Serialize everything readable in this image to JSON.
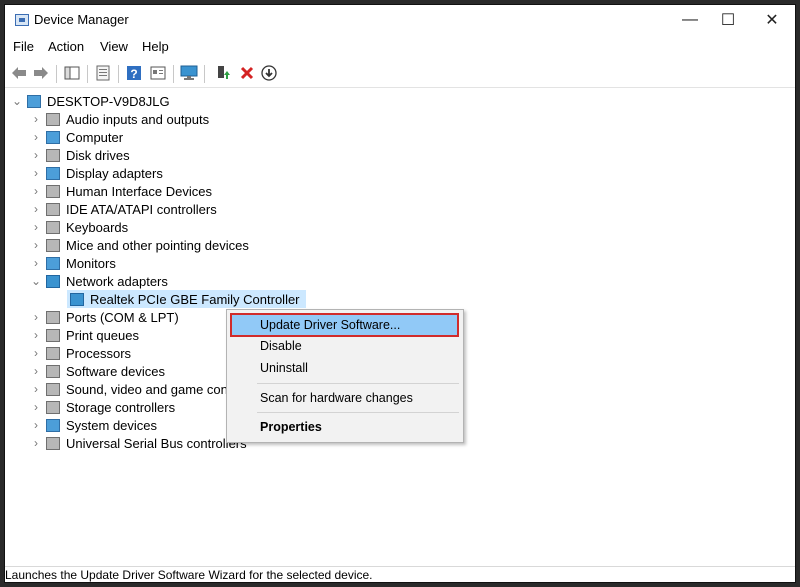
{
  "window": {
    "title": "Device Manager",
    "controls": {
      "minimize": "—",
      "maximize": "☐",
      "close": "✕"
    }
  },
  "menu": [
    "File",
    "Action",
    "View",
    "Help"
  ],
  "toolbar": {
    "icons": [
      "back-icon",
      "forward-icon",
      "show-hide-tree-icon",
      "properties-icon",
      "help-icon",
      "details-icon",
      "scan-hardware-icon",
      "enable-device-icon",
      "uninstall-device-icon",
      "disable-device-icon"
    ]
  },
  "tree": {
    "root": "DESKTOP-V9D8JLG",
    "items": [
      {
        "label": "Audio inputs and outputs",
        "expanded": false
      },
      {
        "label": "Computer",
        "expanded": false
      },
      {
        "label": "Disk drives",
        "expanded": false
      },
      {
        "label": "Display adapters",
        "expanded": false
      },
      {
        "label": "Human Interface Devices",
        "expanded": false
      },
      {
        "label": "IDE ATA/ATAPI controllers",
        "expanded": false
      },
      {
        "label": "Keyboards",
        "expanded": false
      },
      {
        "label": "Mice and other pointing devices",
        "expanded": false
      },
      {
        "label": "Monitors",
        "expanded": false
      },
      {
        "label": "Network adapters",
        "expanded": true
      },
      {
        "label": "Ports (COM & LPT)",
        "expanded": false
      },
      {
        "label": "Print queues",
        "expanded": false
      },
      {
        "label": "Processors",
        "expanded": false
      },
      {
        "label": "Software devices",
        "expanded": false
      },
      {
        "label": "Sound, video and game cont",
        "expanded": false
      },
      {
        "label": "Storage controllers",
        "expanded": false
      },
      {
        "label": "System devices",
        "expanded": false
      },
      {
        "label": "Universal Serial Bus controllers",
        "expanded": false
      }
    ],
    "network_child": "Realtek PCIe GBE Family Controller"
  },
  "context_menu": {
    "items": [
      "Update Driver Software...",
      "Disable",
      "Uninstall",
      "Scan for hardware changes",
      "Properties"
    ]
  },
  "status": {
    "text": "Launches the Update Driver Software Wizard for the selected device."
  },
  "colors": {
    "selection": "#cce8ff",
    "highlight": "#91c9f7",
    "highlight_border": "#d12b2b"
  }
}
